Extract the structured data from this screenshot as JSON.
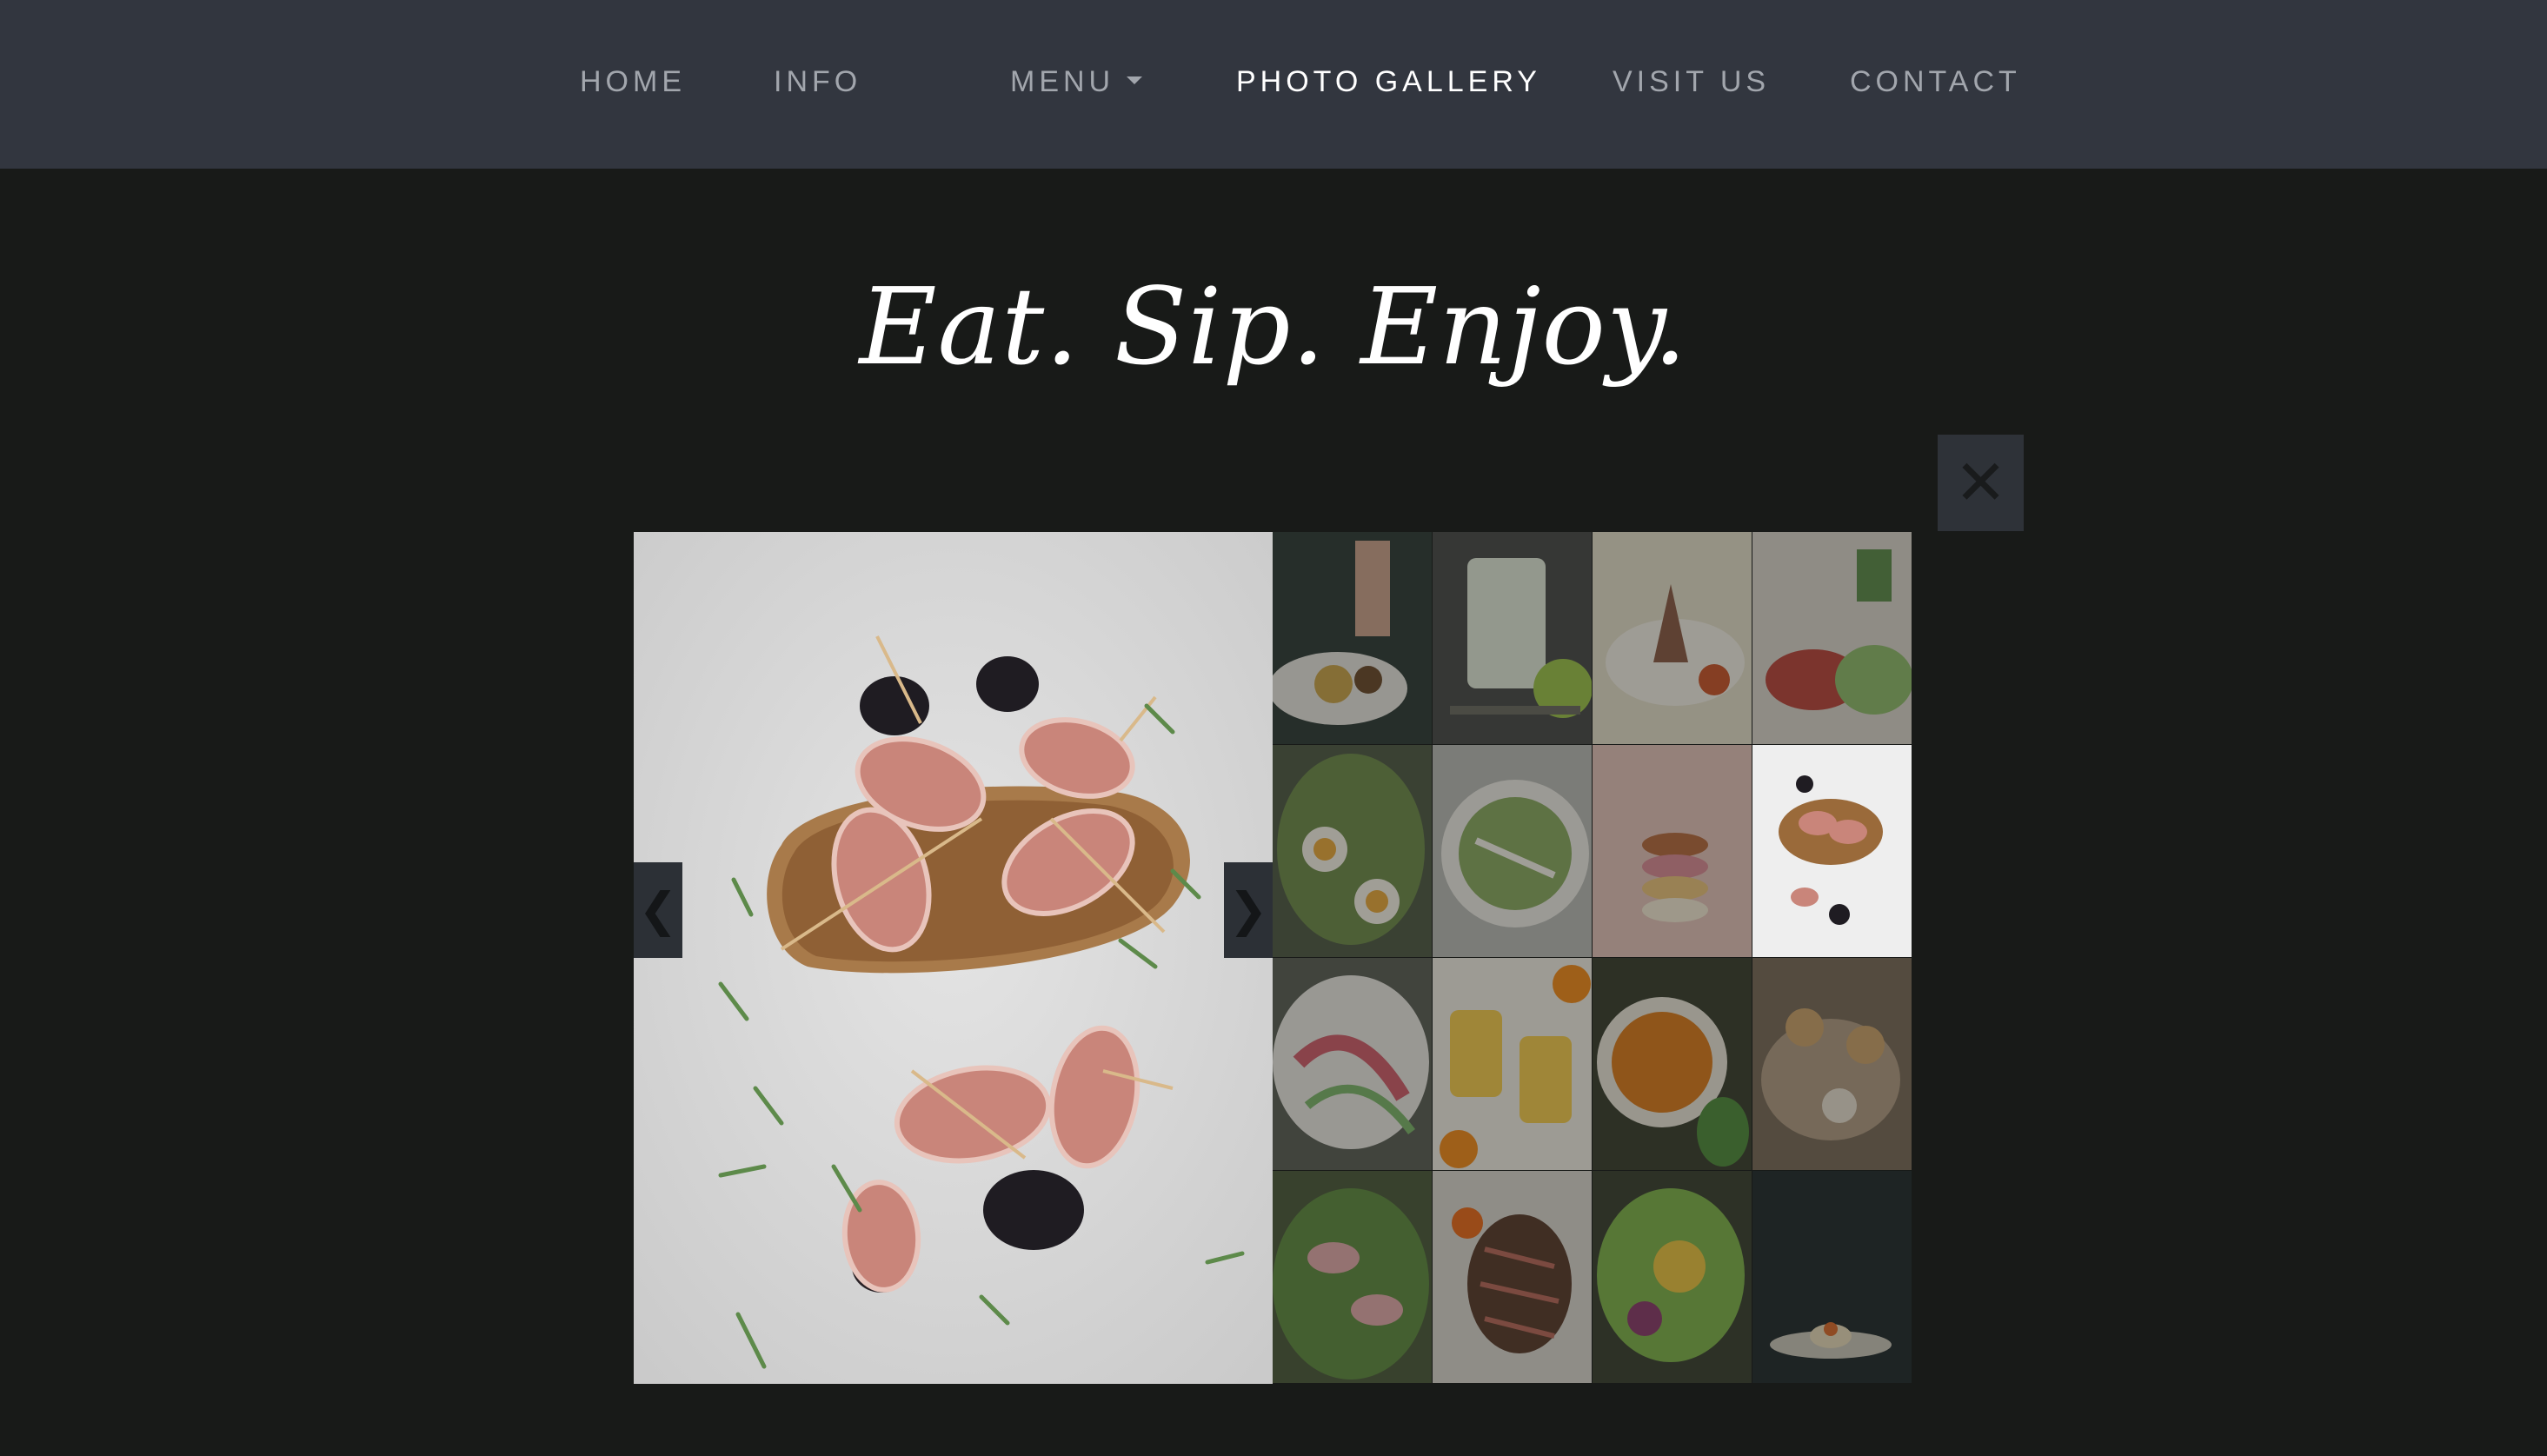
{
  "nav": {
    "items": [
      {
        "label": "HOME"
      },
      {
        "label": "INFO"
      },
      {
        "label": "MENU"
      },
      {
        "label": "PHOTO GALLERY"
      },
      {
        "label": "VISIT US"
      },
      {
        "label": "CONTACT"
      }
    ],
    "active": "PHOTO GALLERY"
  },
  "heading": "Eat. Sip. Enjoy.",
  "lightbox": {
    "close_icon": "close-icon",
    "close_glyph": "✕",
    "prev_glyph": "❮",
    "next_glyph": "❯",
    "featured_photo": "bacon-wrapped-prunes-on-toast",
    "current_index": 8,
    "thumbnails": [
      "plated-dish-with-fork",
      "lime-cocktail",
      "lamb-chops-with-vegetables",
      "tomato-cucumber-toast",
      "avocado-egg-salad",
      "chicken-salad-bowl",
      "stacked-macarons",
      "bacon-wrapped-prunes-on-toast",
      "radish-cucumber-salad",
      "orange-lemonade-glasses",
      "pumpkin-soup-bowl",
      "mushroom-tartlets",
      "prosciutto-green-salad",
      "sliced-steak",
      "lettuce-wrap-salad",
      "dessert-on-plate"
    ]
  },
  "colors": {
    "navbar_bg": "#32363f",
    "page_bg": "#181a18",
    "nav_text": "#a2a6ad",
    "nav_active": "#ffffff"
  }
}
